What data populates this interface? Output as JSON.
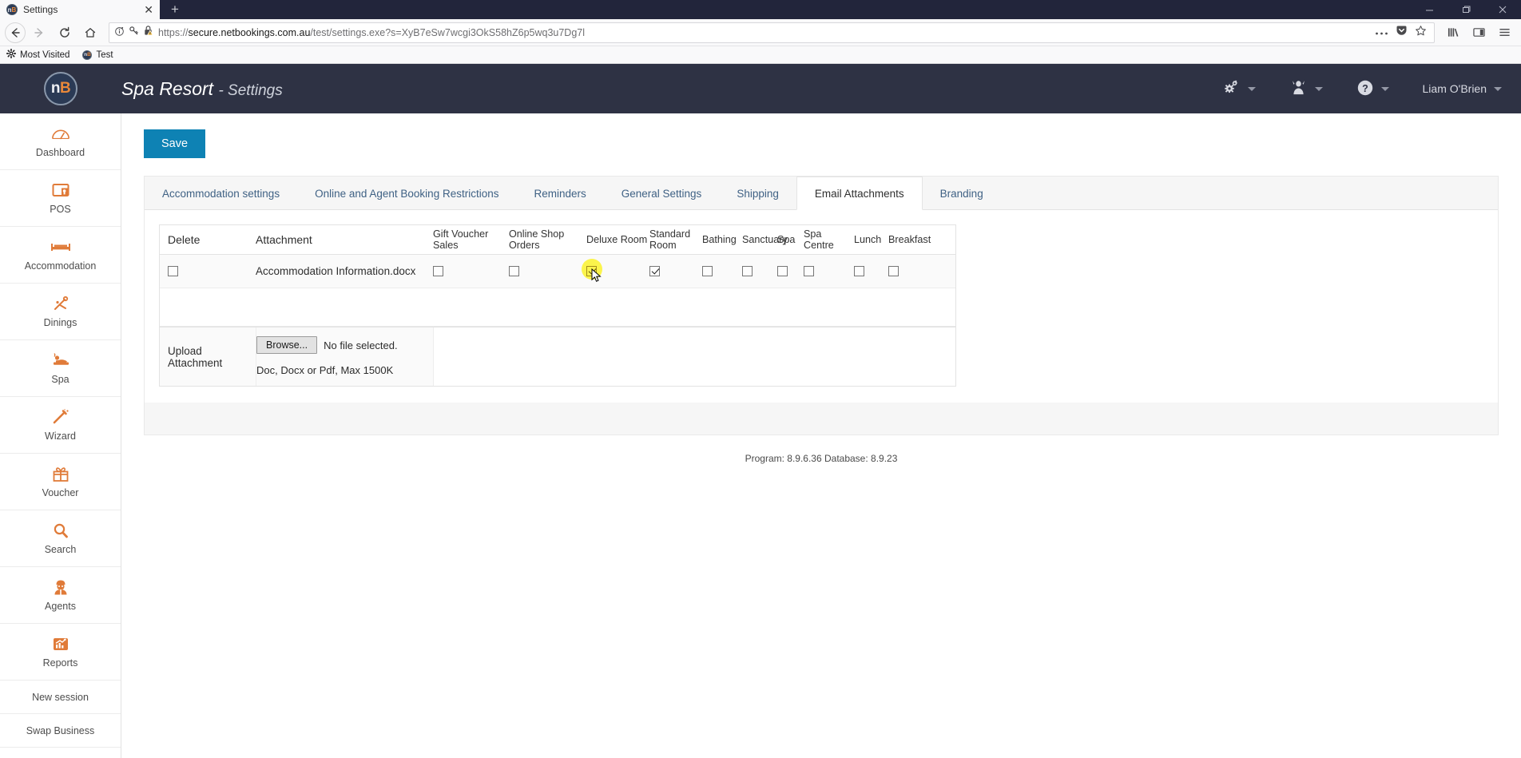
{
  "browser": {
    "tab": {
      "title": "Settings",
      "favicon": "nb-logo-icon",
      "close_label": "✕"
    },
    "newtab_label": "+",
    "window_controls": {
      "minimize": "minimize-icon",
      "maximize": "maximize-icon",
      "close": "close-icon"
    },
    "nav": {
      "back": "back-arrow-icon",
      "forward": "forward-arrow-icon",
      "reload": "reload-icon",
      "home": "home-icon"
    },
    "url": {
      "scheme": "https://",
      "host": "secure.netbookings.com.au",
      "path": "/test/settings.exe?s=XyB7eSw7wcgi3OkS58hZ6p5wq3u7Dg7l",
      "full": "https://secure.netbookings.com.au/test/settings.exe?s=XyB7eSw7wcgi3OkS58hZ6p5wq3u7Dg7l",
      "icons": [
        "info-icon",
        "key-icon",
        "warning-lock-icon"
      ],
      "right_icons": [
        "page-actions-ellipsis-icon",
        "pocket-icon",
        "bookmark-star-icon"
      ]
    },
    "toolbar_right": [
      "library-icon",
      "sidebar-icon",
      "hamburger-menu-icon"
    ],
    "bookmarks": [
      {
        "label": "Most Visited",
        "icon": "gear-icon"
      },
      {
        "label": "Test",
        "icon": "nb-logo-icon"
      }
    ]
  },
  "app": {
    "logo": {
      "n": "n",
      "b": "B"
    },
    "title": "Spa Resort",
    "subtitle": "- Settings",
    "header_actions": [
      {
        "name": "settings-gear",
        "icon": "gears-icon",
        "label": ""
      },
      {
        "name": "user-menu",
        "icon": "person-icon",
        "label": ""
      },
      {
        "name": "help-menu",
        "icon": "question-circle-icon",
        "label": ""
      },
      {
        "name": "account-menu",
        "icon": "",
        "label": "Liam O'Brien"
      }
    ]
  },
  "sidebar": {
    "items": [
      {
        "label": "Dashboard",
        "icon": "gauge-icon"
      },
      {
        "label": "POS",
        "icon": "pos-terminal-icon"
      },
      {
        "label": "Accommodation",
        "icon": "bed-icon"
      },
      {
        "label": "Dinings",
        "icon": "cutlery-icon"
      },
      {
        "label": "Spa",
        "icon": "massage-icon"
      },
      {
        "label": "Wizard",
        "icon": "magic-wand-icon"
      },
      {
        "label": "Voucher",
        "icon": "gift-icon"
      },
      {
        "label": "Search",
        "icon": "search-icon"
      },
      {
        "label": "Agents",
        "icon": "agent-icon"
      },
      {
        "label": "Reports",
        "icon": "chart-icon"
      }
    ],
    "plain_items": [
      {
        "label": "New session"
      },
      {
        "label": "Swap Business"
      }
    ]
  },
  "main": {
    "save_label": "Save",
    "tabs": [
      {
        "label": "Accommodation settings",
        "active": false
      },
      {
        "label": "Online and Agent Booking Restrictions",
        "active": false
      },
      {
        "label": "Reminders",
        "active": false
      },
      {
        "label": "General Settings",
        "active": false
      },
      {
        "label": "Shipping",
        "active": false
      },
      {
        "label": "Email Attachments",
        "active": true
      },
      {
        "label": "Branding",
        "active": false
      }
    ],
    "table": {
      "headers": {
        "delete": "Delete",
        "attachment": "Attachment",
        "columns": [
          "Gift Voucher Sales",
          "Online Shop Orders",
          "Deluxe Room",
          "Standard Room",
          "Bathing",
          "Sanctuary",
          "Spa",
          "Spa Centre",
          "Lunch",
          "Breakfast"
        ]
      },
      "rows": [
        {
          "delete_checked": false,
          "name": "Accommodation Information.docx",
          "checks": [
            false,
            false,
            true,
            true,
            false,
            false,
            false,
            false,
            false,
            false
          ],
          "highlighted_index": 2
        }
      ]
    },
    "upload": {
      "label": "Upload Attachment",
      "browse_label": "Browse...",
      "file_status": "No file selected.",
      "hint": "Doc, Docx or Pdf, Max 1500K"
    },
    "footer": "Program: 8.9.6.36 Database: 8.9.23"
  },
  "colors": {
    "header_bg": "#2e3244",
    "accent_orange": "#e07b39",
    "save_blue": "#0e82b4",
    "tab_link": "#3f6184",
    "highlight_yellow": "#fbf44c"
  }
}
